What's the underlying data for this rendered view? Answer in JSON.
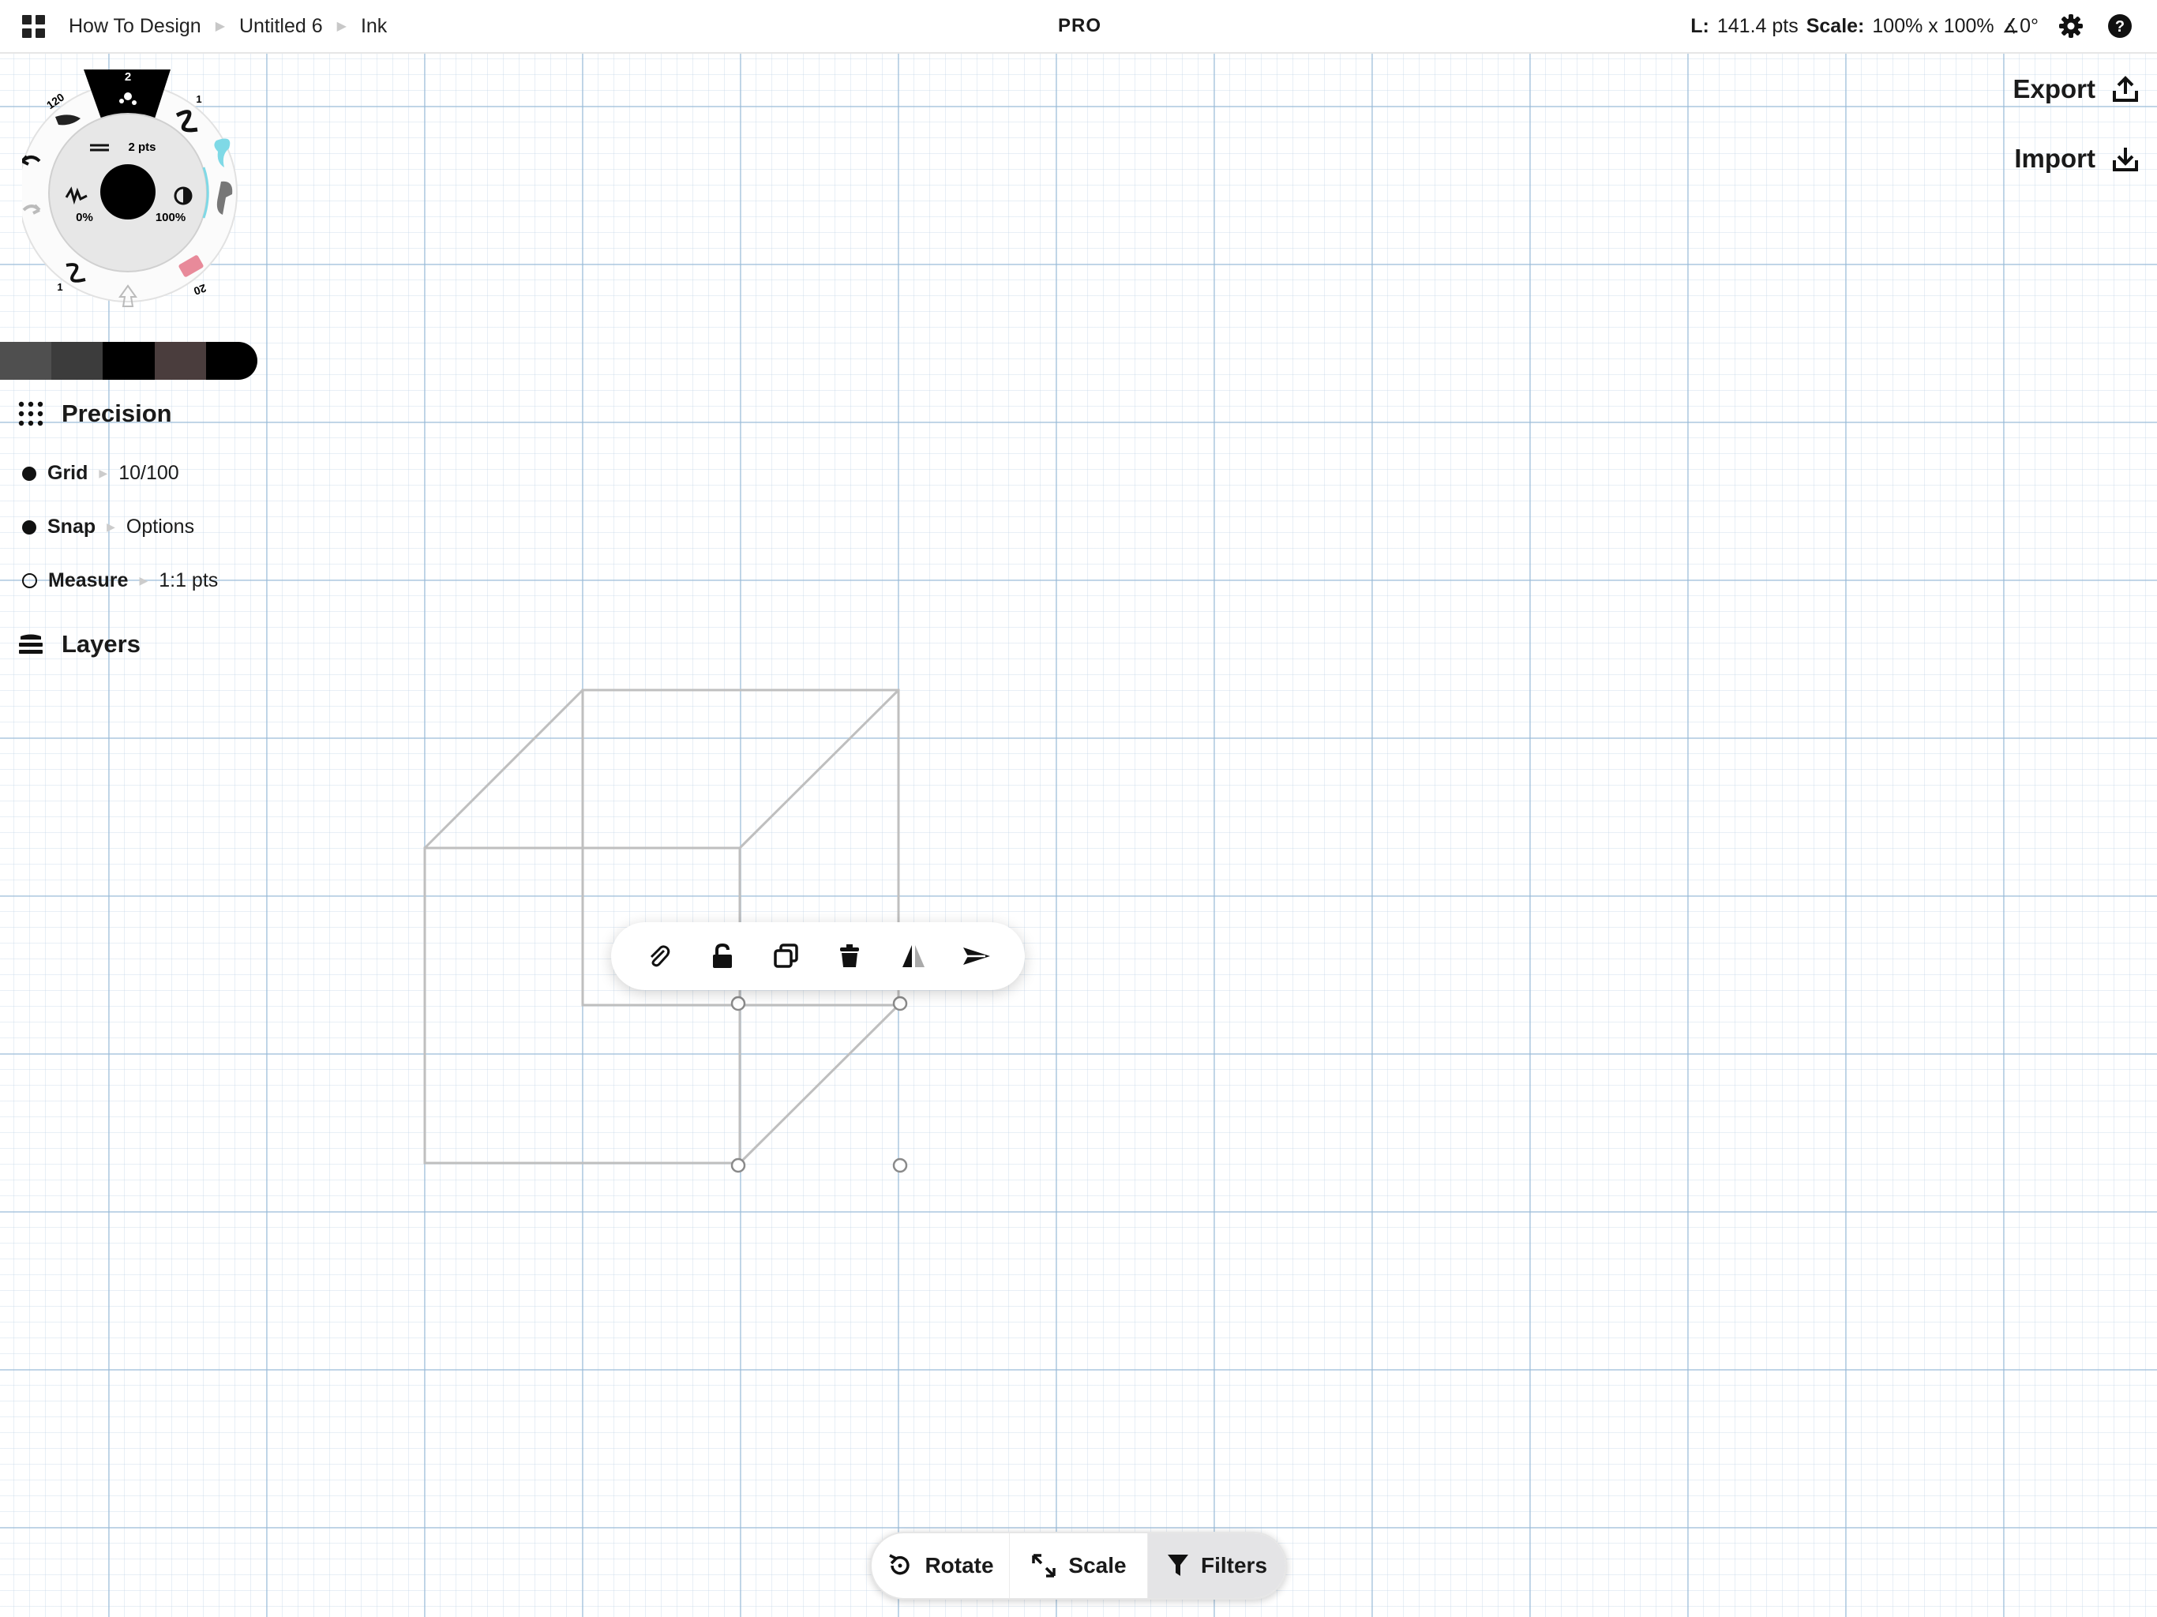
{
  "breadcrumb": {
    "items": [
      "How To Design",
      "Untitled 6",
      "Ink"
    ]
  },
  "header": {
    "badge": "PRO",
    "length_label": "L:",
    "length_value": "141.4 pts",
    "scale_label": "Scale:",
    "scale_value": "100% x 100%",
    "angle_value": "∡0°"
  },
  "actions": {
    "export_label": "Export",
    "import_label": "Import"
  },
  "tool_wheel": {
    "selected_size": "2",
    "size_120": "120",
    "size_1_top": "1",
    "size_1_bottom": "1",
    "size_20": "20",
    "weight_label": "2 pts",
    "smoothing_label": "0%",
    "opacity_label": "100%",
    "accent_cyan": "#7fd9e6",
    "accent_pink": "#e88a9a"
  },
  "palette": {
    "swatches": [
      "#4f4f4f",
      "#3c3c3c",
      "#000000",
      "#4a3d3d",
      "#000000"
    ]
  },
  "precision": {
    "title": "Precision",
    "grid_label": "Grid",
    "grid_value": "10/100",
    "snap_label": "Snap",
    "snap_value": "Options",
    "measure_label": "Measure",
    "measure_value": "1:1 pts"
  },
  "layers": {
    "title": "Layers"
  },
  "selection_toolbar": {
    "icons": [
      "paperclip-icon",
      "unlock-icon",
      "duplicate-icon",
      "trash-icon",
      "flip-icon",
      "send-icon"
    ]
  },
  "bottom_bar": {
    "rotate_label": "Rotate",
    "scale_label": "Scale",
    "filters_label": "Filters"
  }
}
